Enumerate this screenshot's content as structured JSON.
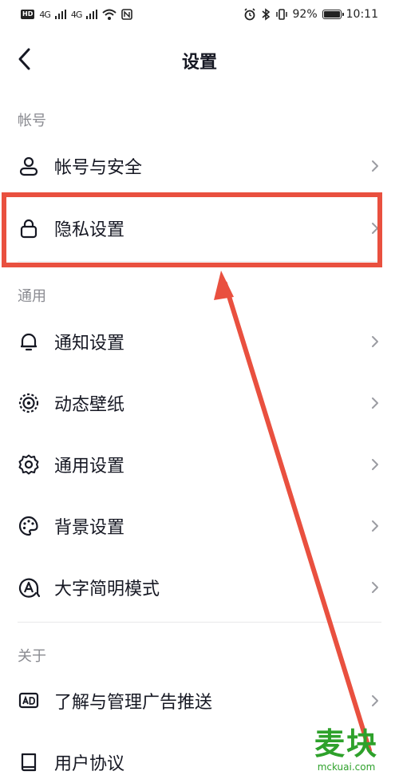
{
  "status_bar": {
    "hd_label": "HD",
    "signal_1": "4G",
    "signal_2": "4G",
    "battery_text": "92%",
    "time": "10:11"
  },
  "nav": {
    "title": "设置"
  },
  "sections": {
    "account": "帐号",
    "general": "通用",
    "about": "关于"
  },
  "rows": {
    "account_security": "帐号与安全",
    "privacy": "隐私设置",
    "notification": "通知设置",
    "live_wallpaper": "动态壁纸",
    "general_settings": "通用设置",
    "background": "背景设置",
    "large_font": "大字简明模式",
    "ads": "了解与管理广告推送",
    "user_agreement": "用户协议"
  },
  "watermark": {
    "brand": "麦块",
    "domain": "mckuai.com"
  },
  "colors": {
    "highlight": "#e9503f",
    "watermark": "#2ea12b"
  },
  "icons": [
    "back-arrow",
    "user",
    "lock",
    "bell",
    "wallpaper",
    "gear",
    "palette",
    "font-a",
    "ad",
    "book"
  ]
}
